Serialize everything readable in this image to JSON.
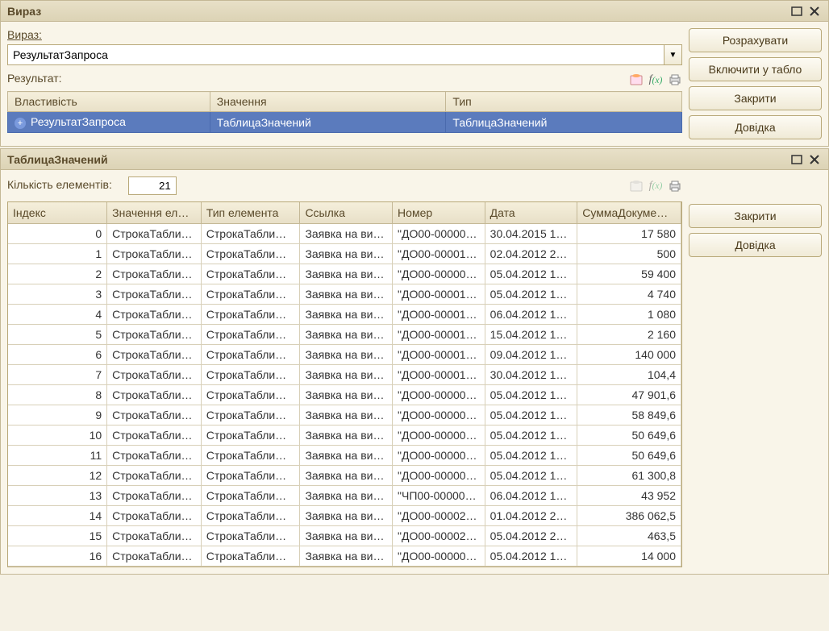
{
  "panel1": {
    "title": "Вираз",
    "expression_label": "Вираз:",
    "expression_value": "РезультатЗапроса",
    "result_label": "Результат:",
    "columns": {
      "property": "Властивість",
      "value": "Значення",
      "type": "Тип"
    },
    "row": {
      "property": "РезультатЗапроса",
      "value": "ТаблицаЗначений",
      "type": "ТаблицаЗначений"
    },
    "buttons": {
      "calculate": "Розрахувати",
      "include": "Включити у табло",
      "close": "Закрити",
      "help": "Довідка"
    }
  },
  "panel2": {
    "title": "ТаблицаЗначений",
    "count_label": "Кількість елементів:",
    "count_value": "21",
    "buttons": {
      "close": "Закрити",
      "help": "Довідка"
    },
    "columns": {
      "index": "Індекс",
      "element_value": "Значення ел…",
      "element_type": "Тип елемента",
      "link": "Ссылка",
      "number": "Номер",
      "date": "Дата",
      "sum": "СуммаДокуме…"
    },
    "rows": [
      {
        "idx": "0",
        "val": "СтрокаТабли…",
        "type": "СтрокаТабли…",
        "link": "Заявка на ви…",
        "num": "\"ДО00-00000…",
        "date": "30.04.2015 1…",
        "sum": "17 580"
      },
      {
        "idx": "1",
        "val": "СтрокаТабли…",
        "type": "СтрокаТабли…",
        "link": "Заявка на ви…",
        "num": "\"ДО00-00001…",
        "date": "02.04.2012 2…",
        "sum": "500"
      },
      {
        "idx": "2",
        "val": "СтрокаТабли…",
        "type": "СтрокаТабли…",
        "link": "Заявка на ви…",
        "num": "\"ДО00-00000…",
        "date": "05.04.2012 1…",
        "sum": "59 400"
      },
      {
        "idx": "3",
        "val": "СтрокаТабли…",
        "type": "СтрокаТабли…",
        "link": "Заявка на ви…",
        "num": "\"ДО00-00001…",
        "date": "05.04.2012 1…",
        "sum": "4 740"
      },
      {
        "idx": "4",
        "val": "СтрокаТабли…",
        "type": "СтрокаТабли…",
        "link": "Заявка на ви…",
        "num": "\"ДО00-00001…",
        "date": "06.04.2012 1…",
        "sum": "1 080"
      },
      {
        "idx": "5",
        "val": "СтрокаТабли…",
        "type": "СтрокаТабли…",
        "link": "Заявка на ви…",
        "num": "\"ДО00-00001…",
        "date": "15.04.2012 1…",
        "sum": "2 160"
      },
      {
        "idx": "6",
        "val": "СтрокаТабли…",
        "type": "СтрокаТабли…",
        "link": "Заявка на ви…",
        "num": "\"ДО00-00001…",
        "date": "09.04.2012 1…",
        "sum": "140 000"
      },
      {
        "idx": "7",
        "val": "СтрокаТабли…",
        "type": "СтрокаТабли…",
        "link": "Заявка на ви…",
        "num": "\"ДО00-00001…",
        "date": "30.04.2012 1…",
        "sum": "104,4"
      },
      {
        "idx": "8",
        "val": "СтрокаТабли…",
        "type": "СтрокаТабли…",
        "link": "Заявка на ви…",
        "num": "\"ДО00-00000…",
        "date": "05.04.2012 1…",
        "sum": "47 901,6"
      },
      {
        "idx": "9",
        "val": "СтрокаТабли…",
        "type": "СтрокаТабли…",
        "link": "Заявка на ви…",
        "num": "\"ДО00-00000…",
        "date": "05.04.2012 1…",
        "sum": "58 849,6"
      },
      {
        "idx": "10",
        "val": "СтрокаТабли…",
        "type": "СтрокаТабли…",
        "link": "Заявка на ви…",
        "num": "\"ДО00-00000…",
        "date": "05.04.2012 1…",
        "sum": "50 649,6"
      },
      {
        "idx": "11",
        "val": "СтрокаТабли…",
        "type": "СтрокаТабли…",
        "link": "Заявка на ви…",
        "num": "\"ДО00-00000…",
        "date": "05.04.2012 1…",
        "sum": "50 649,6"
      },
      {
        "idx": "12",
        "val": "СтрокаТабли…",
        "type": "СтрокаТабли…",
        "link": "Заявка на ви…",
        "num": "\"ДО00-00000…",
        "date": "05.04.2012 1…",
        "sum": "61 300,8"
      },
      {
        "idx": "13",
        "val": "СтрокаТабли…",
        "type": "СтрокаТабли…",
        "link": "Заявка на ви…",
        "num": "\"ЧП00-00000…",
        "date": "06.04.2012 1…",
        "sum": "43 952"
      },
      {
        "idx": "14",
        "val": "СтрокаТабли…",
        "type": "СтрокаТабли…",
        "link": "Заявка на ви…",
        "num": "\"ДО00-00002…",
        "date": "01.04.2012 2…",
        "sum": "386 062,5"
      },
      {
        "idx": "15",
        "val": "СтрокаТабли…",
        "type": "СтрокаТабли…",
        "link": "Заявка на ви…",
        "num": "\"ДО00-00002…",
        "date": "05.04.2012 2…",
        "sum": "463,5"
      },
      {
        "idx": "16",
        "val": "СтрокаТабли…",
        "type": "СтрокаТабли…",
        "link": "Заявка на ви…",
        "num": "\"ДО00-00000…",
        "date": "05.04.2012 1…",
        "sum": "14 000"
      }
    ]
  }
}
